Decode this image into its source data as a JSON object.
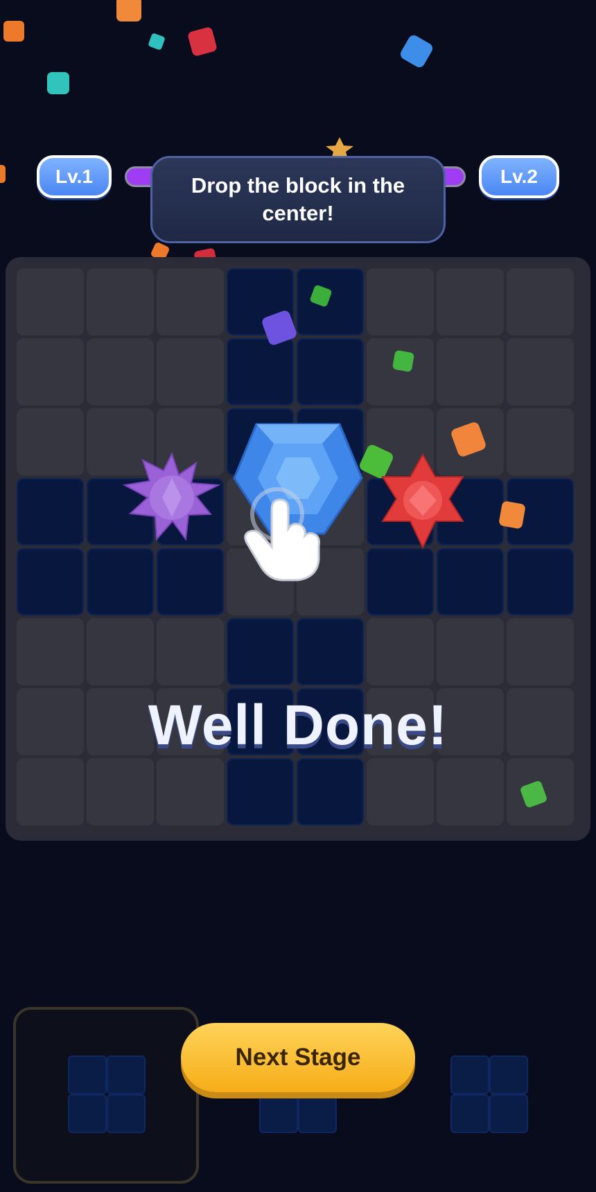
{
  "level": {
    "current_label": "Lv.1",
    "next_label": "Lv.2",
    "progress_fraction": 0.95,
    "bar_color": "#a13cf5"
  },
  "tooltip": {
    "text": "Drop the block in the center!"
  },
  "board": {
    "rows": 8,
    "cols": 8,
    "filled_cells": [
      [
        0,
        3
      ],
      [
        0,
        4
      ],
      [
        1,
        3
      ],
      [
        1,
        4
      ],
      [
        2,
        3
      ],
      [
        2,
        4
      ],
      [
        3,
        0
      ],
      [
        3,
        1
      ],
      [
        3,
        2
      ],
      [
        3,
        5
      ],
      [
        3,
        6
      ],
      [
        3,
        7
      ],
      [
        4,
        0
      ],
      [
        4,
        1
      ],
      [
        4,
        2
      ],
      [
        4,
        5
      ],
      [
        4,
        6
      ],
      [
        4,
        7
      ],
      [
        5,
        3
      ],
      [
        5,
        4
      ],
      [
        6,
        3
      ],
      [
        6,
        4
      ],
      [
        7,
        3
      ],
      [
        7,
        4
      ]
    ],
    "colors": {
      "board_bg": "#2b2c38",
      "empty_cell": "#35363f",
      "filled_cell": "#07173d"
    }
  },
  "gems": {
    "left": "purple-star-gem",
    "center": "blue-hexagon-gem",
    "right": "red-star-gem"
  },
  "message": {
    "headline": "Well Done!"
  },
  "tray": {
    "selected_piece": "2x2-square",
    "center_piece": "1x2-bar",
    "right_piece": "2x2-square"
  },
  "buttons": {
    "next_stage": "Next Stage"
  },
  "icons": {
    "hand": "pointer-hand-icon"
  }
}
